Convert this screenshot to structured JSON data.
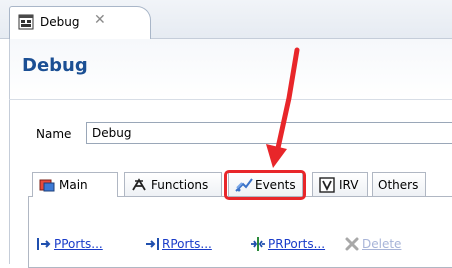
{
  "editor_tab": {
    "title": "Debug"
  },
  "page": {
    "title": "Debug"
  },
  "name_field": {
    "label": "Name",
    "value": "Debug"
  },
  "subtabs": [
    {
      "label": "Main",
      "icon": "main-icon",
      "selected": true
    },
    {
      "label": "Functions",
      "icon": "functions-icon"
    },
    {
      "label": "Events",
      "icon": "events-icon",
      "highlighted": true
    },
    {
      "label": "IRV",
      "icon": "irv-icon"
    },
    {
      "label": "Others",
      "icon": "none"
    }
  ],
  "actions": [
    {
      "label": "PPorts...",
      "icon": "pport-icon"
    },
    {
      "label": "RPorts...",
      "icon": "rport-icon"
    },
    {
      "label": "PRPorts...",
      "icon": "prport-icon"
    },
    {
      "label": "Delete",
      "icon": "delete-icon",
      "disabled": true
    }
  ],
  "colors": {
    "accent_title": "#1b4f94",
    "highlight": "#e8262a",
    "link": "#1a3cc9"
  }
}
